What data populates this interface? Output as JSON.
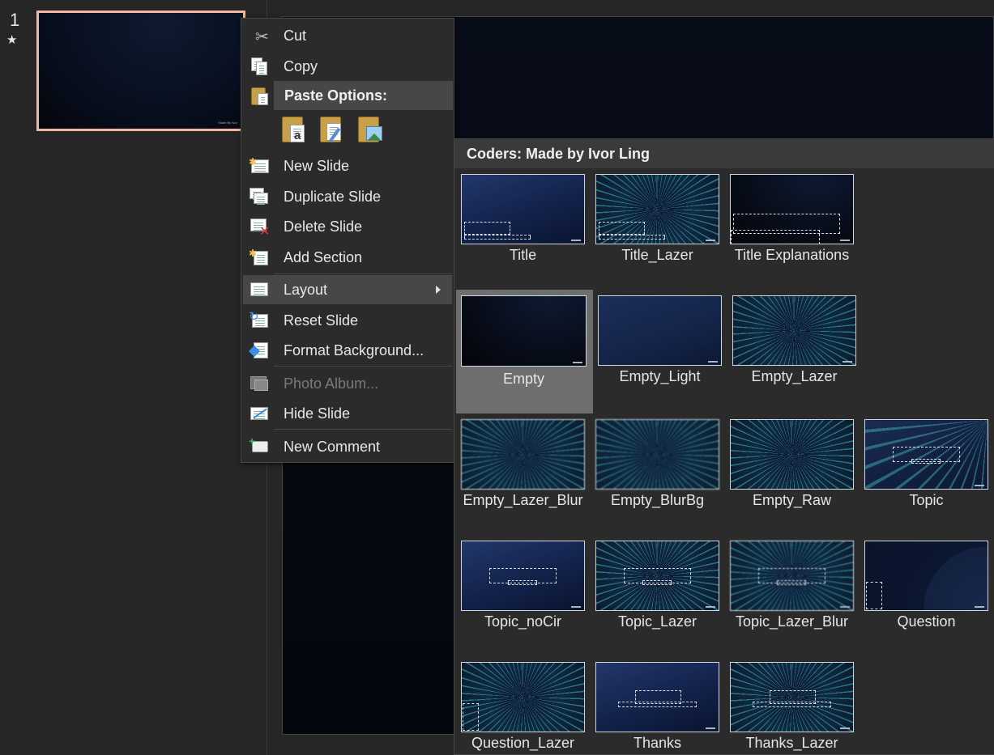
{
  "slide_pane": {
    "slide_number": "1",
    "star": "★",
    "thumbnail_caption": "Made By Ivor"
  },
  "context_menu": {
    "items": [
      {
        "label": "Cut",
        "icon": "scissors-icon"
      },
      {
        "label": "Copy",
        "icon": "copy-icon"
      },
      {
        "label": "Paste Options:",
        "icon": "paste-icon"
      },
      {
        "label": "New Slide",
        "icon": "new-slide-icon"
      },
      {
        "label": "Duplicate Slide",
        "icon": "duplicate-slide-icon"
      },
      {
        "label": "Delete Slide",
        "icon": "delete-slide-icon"
      },
      {
        "label": "Add Section",
        "icon": "add-section-icon"
      },
      {
        "label": "Layout",
        "icon": "layout-icon"
      },
      {
        "label": "Reset Slide",
        "icon": "reset-slide-icon"
      },
      {
        "label": "Format Background...",
        "icon": "format-background-icon"
      },
      {
        "label": "Photo Album...",
        "icon": "photo-album-icon",
        "disabled": true
      },
      {
        "label": "Hide Slide",
        "icon": "hide-slide-icon"
      },
      {
        "label": "New Comment",
        "icon": "new-comment-icon"
      }
    ],
    "paste_buttons": [
      "paste-keep-text-icon",
      "paste-use-destination-theme-icon",
      "paste-picture-icon"
    ]
  },
  "layout_gallery": {
    "header": "Coders: Made by Ivor Ling",
    "selected": "Empty",
    "layouts": [
      "Title",
      "Title_Lazer",
      "Title Explanations",
      "Empty",
      "Empty_Light",
      "Empty_Lazer",
      "Empty_Lazer_Blur",
      "Empty_BlurBg",
      "Empty_Raw",
      "Topic",
      "Topic_noCir",
      "Topic_Lazer",
      "Topic_Lazer_Blur",
      "Question",
      "Question_Lazer",
      "Thanks",
      "Thanks_Lazer"
    ]
  },
  "colors": {
    "background": "#262626",
    "menu": "#2b2b2b",
    "menu_highlight": "#474747",
    "selection_border": "#f4b8a0",
    "selected_tile": "#6e6e6e"
  }
}
